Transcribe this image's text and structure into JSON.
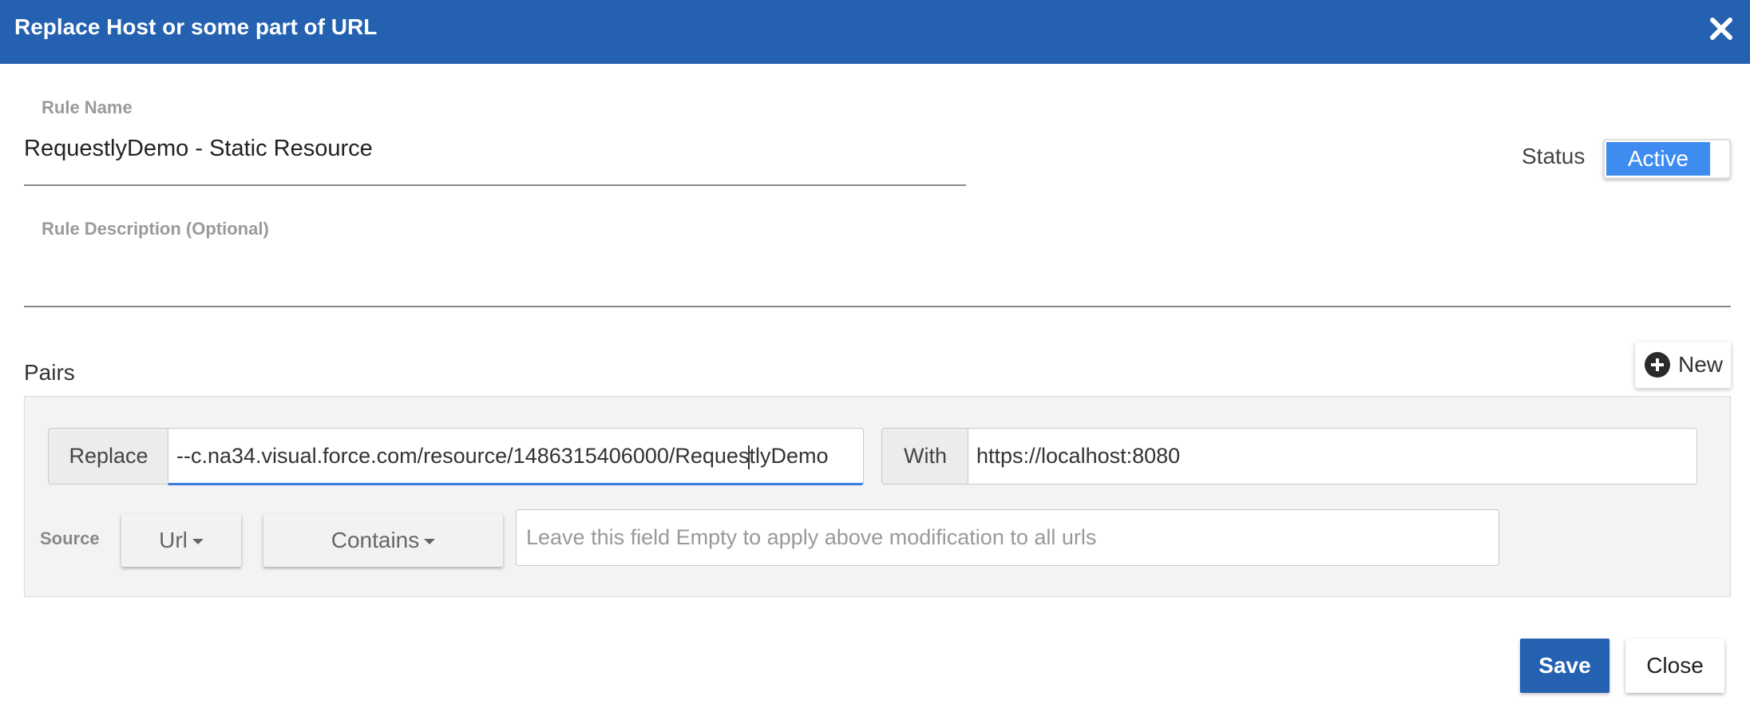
{
  "dialog": {
    "title": "Replace Host or some part of URL",
    "close_icon": "close-icon"
  },
  "rule_name": {
    "label": "Rule Name",
    "value": "RequestlyDemo - Static Resource"
  },
  "rule_description": {
    "label": "Rule Description (Optional)",
    "value": ""
  },
  "status": {
    "label": "Status",
    "toggle_text": "Active",
    "enabled": true
  },
  "pairs": {
    "label": "Pairs",
    "new_button": {
      "icon": "plus-circle-icon",
      "label": "New"
    },
    "items": [
      {
        "replace_label": "Replace",
        "replace_value_before_caret": "--c.na34.visual.force.com/resource/1486315406000/Reques",
        "replace_value_after_caret": "tlyDemo",
        "with_label": "With",
        "with_value": "https://localhost:8080",
        "source_label": "Source",
        "source_key": "Url",
        "source_operator": "Contains",
        "source_value_placeholder": "Leave this field Empty to apply above modification to all urls"
      }
    ]
  },
  "footer": {
    "save_label": "Save",
    "close_label": "Close"
  },
  "colors": {
    "header": "#2461b0",
    "toggle_active": "#3f8cf0",
    "focus_underline": "#3a7be0"
  }
}
